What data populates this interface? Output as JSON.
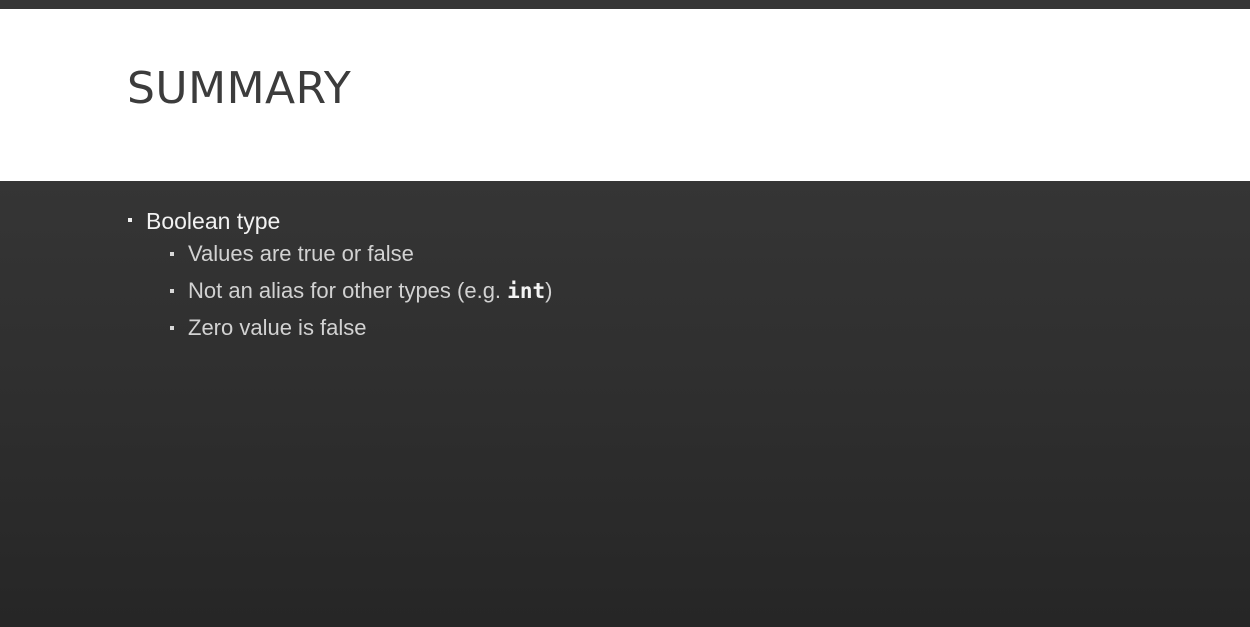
{
  "slide": {
    "title": "SUMMARY",
    "bullets": [
      {
        "text": "Boolean type",
        "sub": [
          {
            "text": "Values are true or false"
          },
          {
            "pre": "Not an alias for other types (e.g. ",
            "code": "int",
            "post": ")"
          },
          {
            "text": "Zero value is false"
          }
        ]
      }
    ]
  },
  "colors": {
    "title_band": "#ffffff",
    "title_text": "#3c3c3c",
    "content_background": "#2f2f2f",
    "primary_bullet_text": "#f2f2f2",
    "secondary_bullet_text": "#d2d2d2"
  }
}
